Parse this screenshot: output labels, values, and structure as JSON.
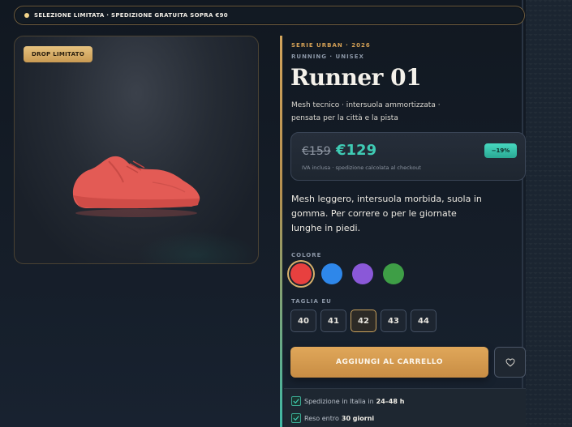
{
  "topbar": {
    "text": "SELEZIONE LIMITATA · SPEDIZIONE GRATUITA SOPRA €90"
  },
  "image_card": {
    "badge": "DROP LIMITATO",
    "product_color": "#e35b55"
  },
  "product": {
    "eyebrow": "SERIE URBAN · 2026",
    "subeyebrow": "RUNNING · UNISEX",
    "title": "Runner 01",
    "short_description": "Mesh tecnico · intersuola ammortizzata · pensata per la città e la pista",
    "long_description": "Mesh leggero, intersuola morbida, suola in gomma. Per correre o per le giornate lunghe in piedi."
  },
  "price": {
    "old": "€159",
    "new": "€129",
    "note": "IVA inclusa · spedizione calcolata al checkout",
    "discount": "−19%"
  },
  "colors": {
    "label": "COLORE",
    "options": [
      "#e8403f",
      "#2e87ea",
      "#8a58d8",
      "#3e9e46"
    ],
    "selected_index": 0
  },
  "sizes": {
    "label": "TAGLIA EU",
    "options": [
      "40",
      "41",
      "42",
      "43",
      "44"
    ],
    "selected": "42"
  },
  "actions": {
    "add_to_cart": "AGGIUNGI AL CARRELLO",
    "wishlist_icon": "heart-icon"
  },
  "shipping": [
    {
      "prefix": "Spedizione in Italia in",
      "highlight": "24–48 h"
    },
    {
      "prefix": "Reso entro",
      "highlight": "30 giorni"
    }
  ],
  "theme": {
    "accent_gold": "#d4a055",
    "accent_teal": "#3fcbb4"
  }
}
